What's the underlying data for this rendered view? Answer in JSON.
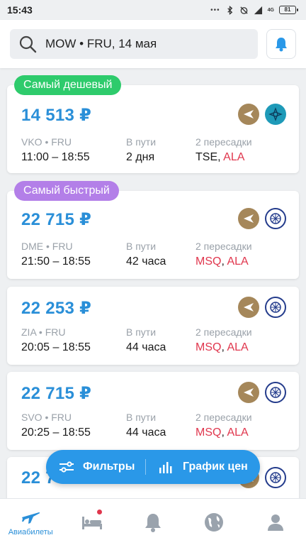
{
  "status": {
    "time": "15:43",
    "battery": "81",
    "dots": "•••",
    "net": "4G"
  },
  "search": {
    "query": "MOW • FRU, 14 мая"
  },
  "cards": [
    {
      "badge": "Самый дешевый",
      "price": "14 513 ₽",
      "route": "VKO • FRU",
      "times": "11:00 – 18:55",
      "duration_label": "В пути",
      "duration": "2 дня",
      "transfers_label": "2 пересадки",
      "stop1": "TSE",
      "stop2": "ALA"
    },
    {
      "badge": "Самый быстрый",
      "price": "22 715 ₽",
      "route": "DME • FRU",
      "times": "21:50 – 18:55",
      "duration_label": "В пути",
      "duration": "42 часа",
      "transfers_label": "2 пересадки",
      "stop1": "MSQ",
      "stop2": "ALA"
    },
    {
      "price": "22 253 ₽",
      "route": "ZIA • FRU",
      "times": "20:05 – 18:55",
      "duration_label": "В пути",
      "duration": "44 часа",
      "transfers_label": "2 пересадки",
      "stop1": "MSQ",
      "stop2": "ALA"
    },
    {
      "price": "22 715 ₽",
      "route": "SVO • FRU",
      "times": "20:25 – 18:55",
      "duration_label": "В пути",
      "duration": "44 часа",
      "transfers_label": "2 пересадки",
      "stop1": "MSQ",
      "stop2": "ALA"
    },
    {
      "price": "22 7"
    }
  ],
  "fab": {
    "filters": "Фильтры",
    "price_chart": "График цен"
  },
  "tabs": [
    {
      "label": "Авиабилеты",
      "icon": "plane-icon"
    },
    {
      "label": "",
      "icon": "hotel-bed-icon"
    },
    {
      "label": "",
      "icon": "bell-icon"
    },
    {
      "label": "",
      "icon": "globe-icon"
    },
    {
      "label": "",
      "icon": "profile-icon"
    }
  ],
  "colors": {
    "accent": "#2a98e8",
    "price": "#2a8fd8",
    "cheapest": "#2ecb6c",
    "fastest": "#b37fe8",
    "transfer_red": "#e0364d"
  }
}
